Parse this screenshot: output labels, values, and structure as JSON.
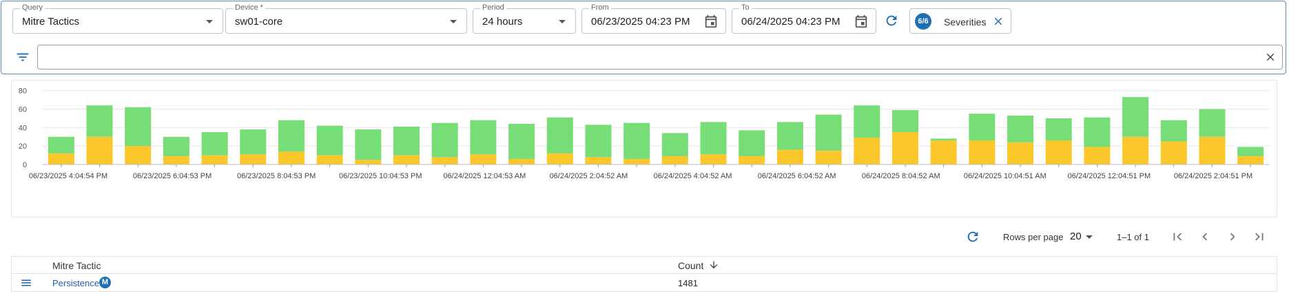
{
  "filters": {
    "query": {
      "label": "Query",
      "value": "Mitre Tactics"
    },
    "device": {
      "label": "Device *",
      "value": "sw01-core"
    },
    "period": {
      "label": "Period",
      "value": "24 hours"
    },
    "from": {
      "label": "From",
      "value": "06/23/2025 04:23 PM"
    },
    "to": {
      "label": "To",
      "value": "06/24/2025 04:23 PM"
    },
    "severities": {
      "count": "6/6",
      "label": "Severities"
    },
    "search": {
      "value": "",
      "placeholder": ""
    }
  },
  "chart_data": {
    "type": "bar",
    "stacked": true,
    "ylim": [
      0,
      85
    ],
    "yticks": [
      0,
      20,
      40,
      60,
      80
    ],
    "grid": true,
    "x_tick_labels": [
      "06/23/2025 4:04:54 PM",
      "06/23/2025 6:04:53 PM",
      "06/23/2025 8:04:53 PM",
      "06/23/2025 10:04:53 PM",
      "06/24/2025 12:04:53 AM",
      "06/24/2025 2:04:52 AM",
      "06/24/2025 4:04:52 AM",
      "06/24/2025 6:04:52 AM",
      "06/24/2025 8:04:52 AM",
      "06/24/2025 10:04:51 AM",
      "06/24/2025 12:04:51 PM",
      "06/24/2025 2:04:51 PM"
    ],
    "series": [
      {
        "color": "#fcc72b",
        "values": [
          12,
          30,
          20,
          9,
          10,
          11,
          14,
          10,
          5,
          10,
          8,
          11,
          6,
          12,
          8,
          6,
          9,
          11,
          9,
          16,
          15,
          29,
          35,
          26,
          26,
          24,
          26,
          19,
          30,
          25,
          30,
          9
        ]
      },
      {
        "color": "#77dd77",
        "values": [
          18,
          34,
          42,
          21,
          25,
          27,
          34,
          32,
          33,
          31,
          37,
          37,
          38,
          39,
          35,
          39,
          25,
          35,
          28,
          30,
          39,
          35,
          24,
          2,
          29,
          29,
          24,
          32,
          43,
          23,
          30,
          10
        ]
      }
    ]
  },
  "pager": {
    "rows_label": "Rows per page",
    "rows_value": "20",
    "range": "1–1 of 1"
  },
  "table": {
    "headers": {
      "tactic": "Mitre Tactic",
      "count": "Count"
    },
    "rows": [
      {
        "tactic": "Persistence",
        "badge": "M",
        "count": "1481"
      }
    ]
  },
  "colors": {
    "accent": "#1f6fb5",
    "border_focus": "#5b8cc8",
    "green": "#77dd77",
    "yellow": "#fcc72b"
  }
}
